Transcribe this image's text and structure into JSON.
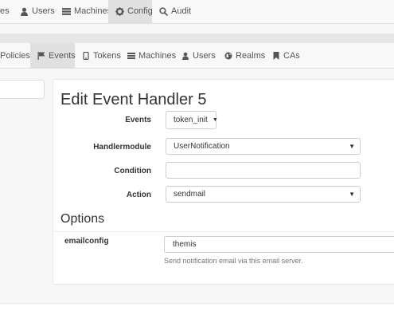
{
  "topnav": {
    "items": [
      {
        "label": "es",
        "icon": "none"
      },
      {
        "label": "Users",
        "icon": "user-icon"
      },
      {
        "label": "Machines",
        "icon": "list-icon"
      },
      {
        "label": "Config",
        "icon": "gear-icon",
        "active": true
      },
      {
        "label": "Audit",
        "icon": "search-icon"
      }
    ]
  },
  "subnav": {
    "items": [
      {
        "label": "Policies"
      },
      {
        "label": "Events",
        "icon": "flag-icon",
        "active": true
      },
      {
        "label": "Tokens",
        "icon": "phone-icon"
      },
      {
        "label": "Machines",
        "icon": "list-icon"
      },
      {
        "label": "Users",
        "icon": "user-icon"
      },
      {
        "label": "Realms",
        "icon": "globe-icon"
      },
      {
        "label": "CAs",
        "icon": "bookmark-icon"
      }
    ]
  },
  "form": {
    "title": "Edit Event Handler 5",
    "events_label": "Events",
    "events_value": "token_init",
    "handlermodule_label": "Handlermodule",
    "handlermodule_value": "UserNotification",
    "condition_label": "Condition",
    "condition_value": "",
    "action_label": "Action",
    "action_value": "sendmail"
  },
  "options": {
    "title": "Options",
    "emailconfig_label": "emailconfig",
    "emailconfig_value": "themis",
    "emailconfig_help": "Send notification email via this email server."
  }
}
